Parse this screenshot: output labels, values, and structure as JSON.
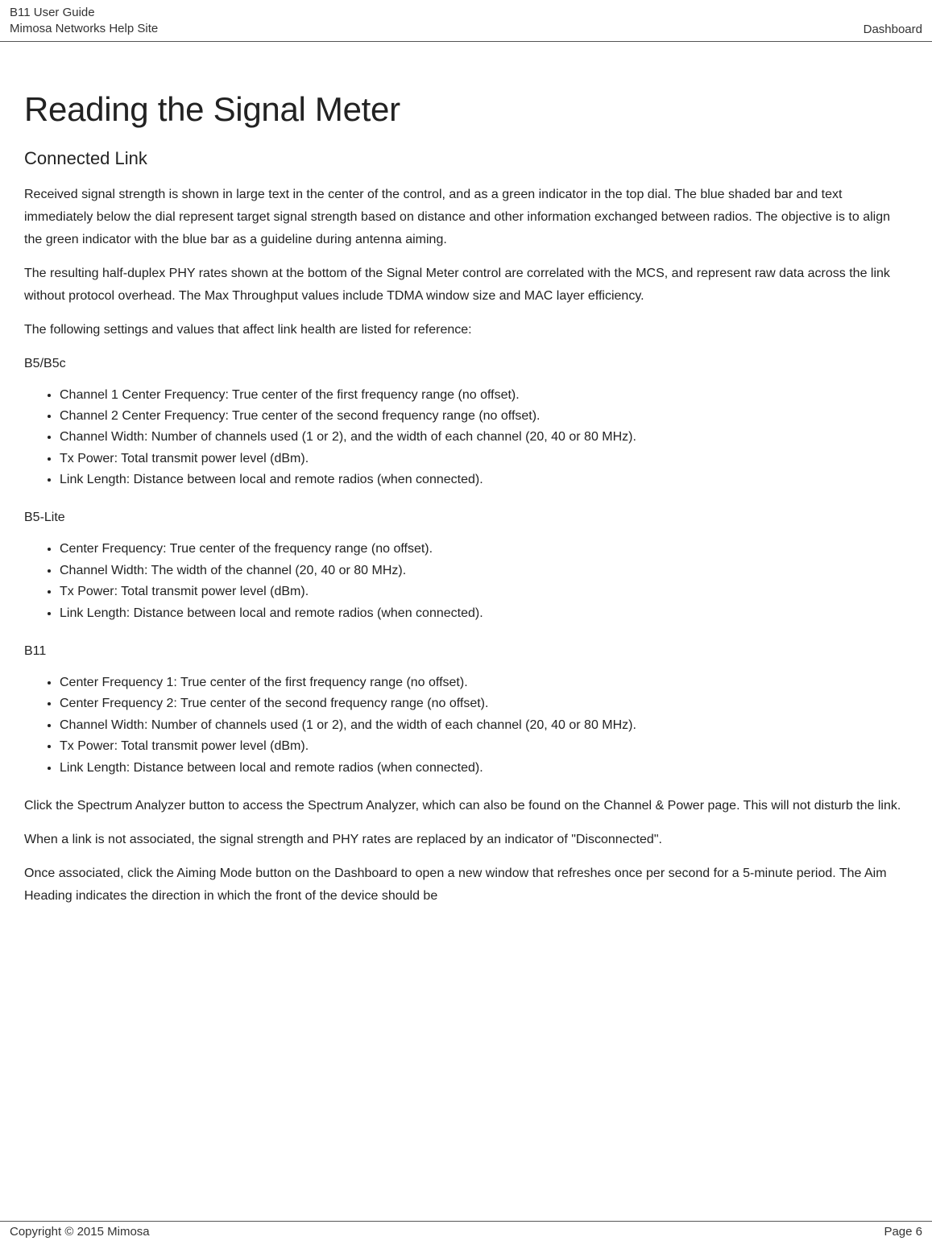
{
  "header": {
    "line1": "B11 User Guide",
    "line2": "Mimosa Networks Help Site",
    "right": "Dashboard"
  },
  "title": "Reading the Signal Meter",
  "subtitle": "Connected Link",
  "para1": "Received signal strength is shown in large text in the center of the control, and as a green indicator in the top dial. The blue shaded bar and text immediately below the dial represent target signal strength based on distance and other information exchanged between radios. The objective is to align the green indicator with the blue bar as a guideline during antenna aiming.",
  "para2": "The resulting half-duplex PHY rates shown at the bottom of the Signal Meter control are correlated with the MCS, and represent raw data across the link without protocol overhead. The Max Throughput values include TDMA window size and MAC layer efficiency.",
  "para3": "The following settings and values that affect link health are listed for reference:",
  "sectionA": {
    "label": "B5/B5c",
    "items": {
      "i0": "Channel 1 Center Frequency: True center of the first frequency range (no offset).",
      "i1": "Channel 2 Center Frequency: True center of the second frequency range (no offset).",
      "i2": "Channel Width: Number of channels used (1 or 2), and the width of each channel (20, 40 or 80 MHz).",
      "i3": "Tx Power: Total transmit power level (dBm).",
      "i4": "Link Length: Distance between local and remote radios (when connected)."
    }
  },
  "sectionB": {
    "label": "B5-Lite",
    "items": {
      "i0": "Center Frequency: True center of the frequency range (no offset).",
      "i1": "Channel Width: The width of the channel (20, 40 or 80 MHz).",
      "i2": "Tx Power: Total transmit power level (dBm).",
      "i3": "Link Length: Distance between local and remote radios (when connected)."
    }
  },
  "sectionC": {
    "label": "B11",
    "items": {
      "i0": "Center Frequency 1: True center of the first frequency range (no offset).",
      "i1": "Center Frequency 2: True center of the second frequency range (no offset).",
      "i2": "Channel Width: Number of channels used (1 or 2), and the width of each channel (20, 40 or 80 MHz).",
      "i3": "Tx Power: Total transmit power level (dBm).",
      "i4": "Link Length: Distance between local and remote radios (when connected)."
    }
  },
  "para4": "Click the Spectrum Analyzer button to access the Spectrum Analyzer, which can also be found on the Channel & Power page. This will not disturb the link.",
  "para5": "When a link is not associated, the signal strength and PHY rates are replaced by an indicator of \"Disconnected\".",
  "para6": "Once associated, click the Aiming Mode button on the Dashboard to open a new window that refreshes once per second for a 5-minute period. The Aim Heading indicates the direction in which the front of the device should be",
  "footer": {
    "left": "Copyright © 2015 Mimosa",
    "right": "Page 6"
  }
}
